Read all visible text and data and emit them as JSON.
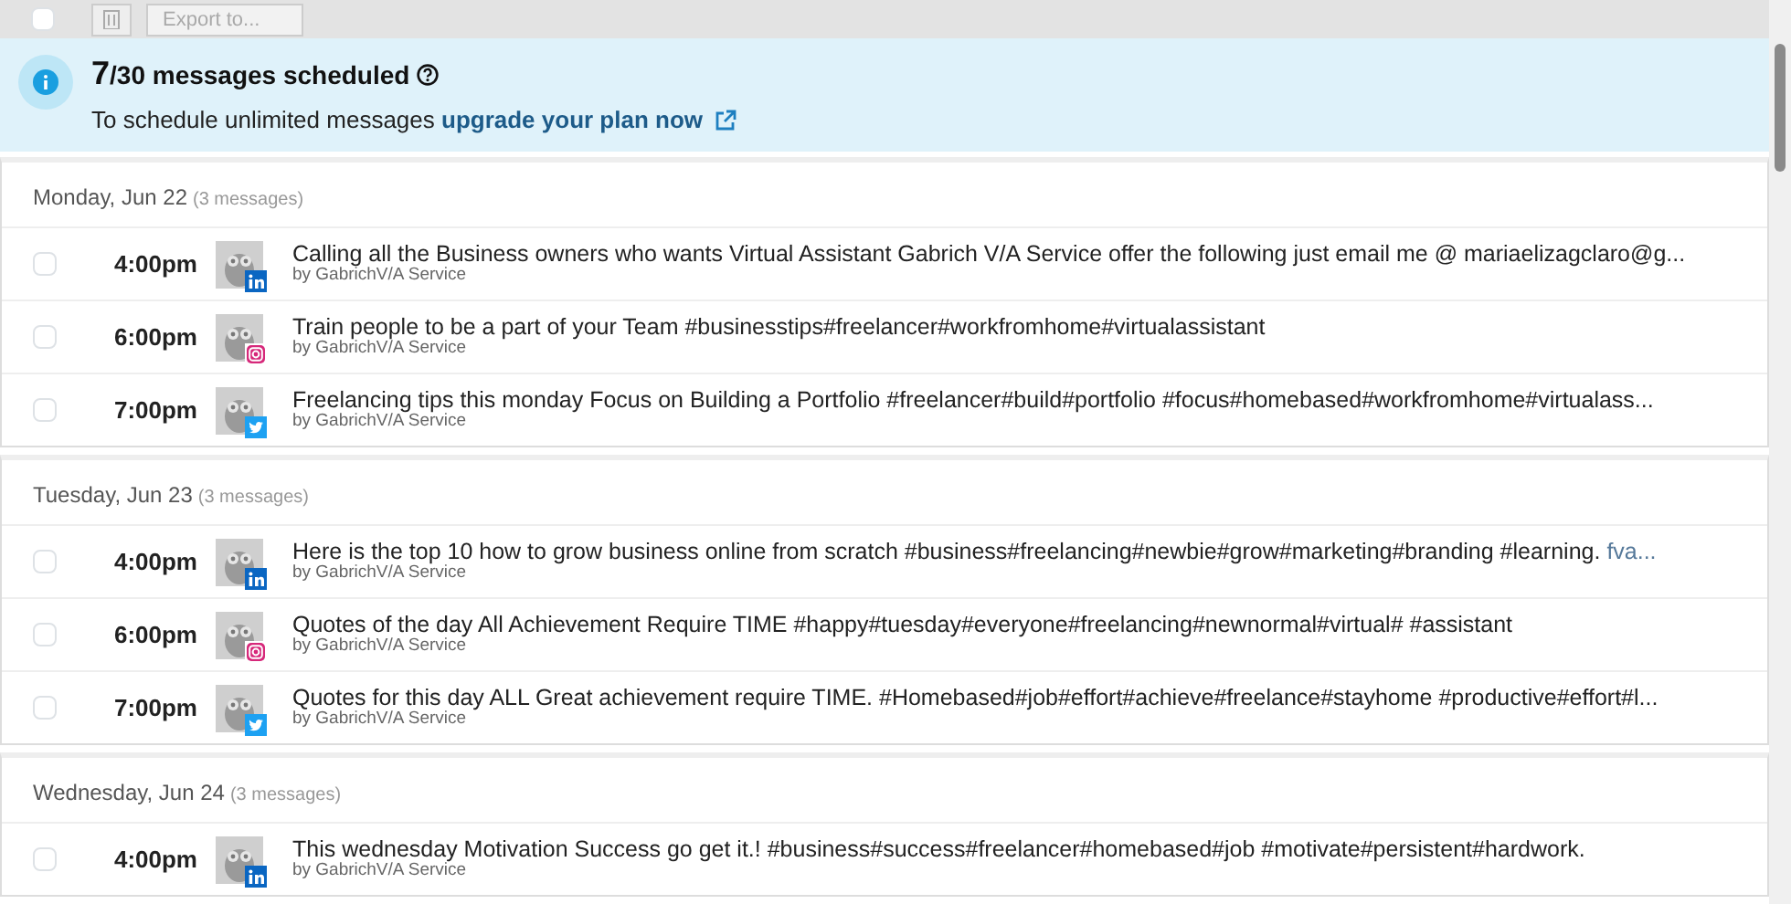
{
  "toolbar": {
    "select_all": {
      "checked": false
    },
    "export": {
      "placeholder": "Export to..."
    }
  },
  "banner": {
    "count": "7",
    "limit": "/30 messages scheduled",
    "text": "To schedule unlimited messages",
    "link": "upgrade your plan now"
  },
  "days": [
    {
      "title": "Monday, Jun 22",
      "count": "(3 messages)",
      "messages": [
        {
          "checked": false,
          "time": "4:00pm",
          "kind": "linkedin",
          "text": "Calling all the Business owners who wants Virtual Assistant Gabrich V/A Service offer the following just email me @ mariaelizagclaro@g...",
          "author": "by GabrichV/A Service"
        },
        {
          "checked": false,
          "time": "6:00pm",
          "kind": "instagram",
          "text": "Train people to be a part of your Team #businesstips#freelancer#workfromhome#virtualassistant",
          "author": "by GabrichV/A Service"
        },
        {
          "checked": false,
          "time": "7:00pm",
          "kind": "twitter",
          "text": "Freelancing tips this monday Focus on Building a Portfolio #freelancer#build#portfolio #focus#homebased#workfromhome#virtualass...",
          "author": "by GabrichV/A Service"
        }
      ]
    },
    {
      "title": "Tuesday, Jun 23",
      "count": "(3 messages)",
      "messages": [
        {
          "checked": false,
          "time": "4:00pm",
          "kind": "linkedin",
          "text": "Here is the top 10 how to grow business online from scratch #business#freelancing#newbie#grow#marketing#branding #learning.",
          "link": "fva...",
          "author": "by GabrichV/A Service"
        },
        {
          "checked": false,
          "time": "6:00pm",
          "kind": "instagram",
          "text": "Quotes of the day All Achievement Require TIME #happy#tuesday#everyone#freelancing#newnormal#virtual# #assistant",
          "author": "by GabrichV/A Service"
        },
        {
          "checked": false,
          "time": "7:00pm",
          "kind": "twitter",
          "text": "Quotes for this day ALL Great achievement require TIME. #Homebased#job#effort#achieve#freelance#stayhome #productive#effort#l...",
          "author": "by GabrichV/A Service"
        }
      ]
    },
    {
      "title": "Wednesday, Jun 24",
      "count": "(3 messages)",
      "messages": [
        {
          "checked": false,
          "time": "4:00pm",
          "kind": "linkedin",
          "text": "This wednesday Motivation Success go get it.! #business#success#freelancer#homebased#job #motivate#persistent#hardwork.",
          "author": "by GabrichV/A Service"
        }
      ]
    }
  ]
}
